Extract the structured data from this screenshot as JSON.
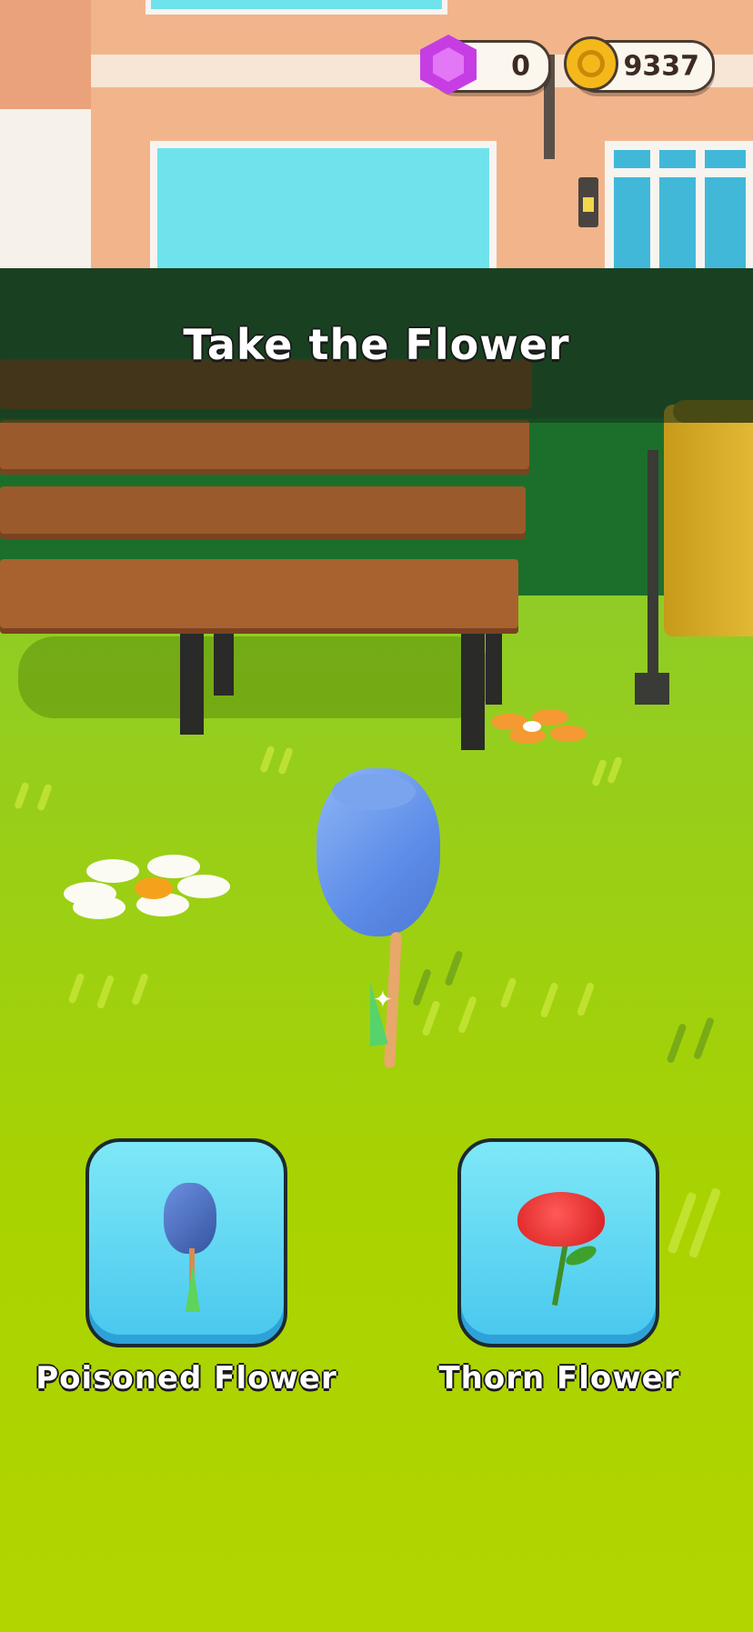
{
  "hud": {
    "gems": "0",
    "coins": "9337",
    "gem_icon": "purple-gem-icon",
    "coin_icon": "gold-coin-icon"
  },
  "prompt": {
    "title": "Take the Flower"
  },
  "choices": [
    {
      "label": "Poisoned Flower",
      "icon": "blue-tulip-icon"
    },
    {
      "label": "Thorn Flower",
      "icon": "red-rose-icon"
    }
  ],
  "colors": {
    "button_fill": "#5ad3f2",
    "grass": "#a9d300",
    "banner": "#142d19"
  }
}
